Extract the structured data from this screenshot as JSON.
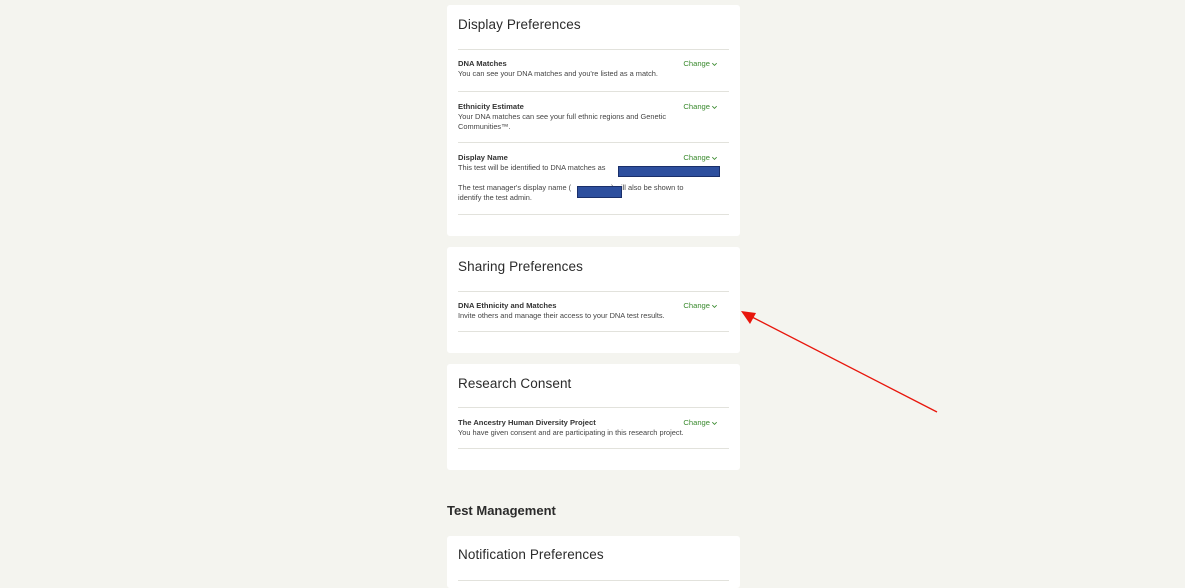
{
  "display_preferences": {
    "title": "Display Preferences",
    "dna_matches": {
      "title": "DNA Matches",
      "description": "You can see your DNA matches and you're listed as a match.",
      "change_label": "Change"
    },
    "ethnicity_estimate": {
      "title": "Ethnicity Estimate",
      "description": "Your DNA matches can see your full ethnic regions and Genetic Communities™.",
      "change_label": "Change"
    },
    "display_name": {
      "title": "Display Name",
      "description": "This test will be identified to DNA matches as",
      "manager_prefix": "The test manager's display name (",
      "manager_suffix": ") will also be shown to identify the test admin.",
      "change_label": "Change"
    }
  },
  "sharing_preferences": {
    "title": "Sharing Preferences",
    "dna_ethnicity_matches": {
      "title": "DNA Ethnicity and Matches",
      "description": "Invite others and manage their access to your DNA test results.",
      "change_label": "Change"
    }
  },
  "research_consent": {
    "title": "Research Consent",
    "human_diversity": {
      "title": "The Ancestry Human Diversity Project",
      "description": "You have given consent and are participating in this research project.",
      "change_label": "Change"
    }
  },
  "test_management": {
    "heading": "Test Management"
  },
  "notification_preferences": {
    "title": "Notification Preferences"
  },
  "colors": {
    "background": "#f4f4ef",
    "link_green": "#3a8a2e",
    "redaction": "#2d4f9e",
    "annotation_arrow": "#e8160c"
  },
  "icons": {
    "change_chevron": "chevron-down-icon"
  }
}
